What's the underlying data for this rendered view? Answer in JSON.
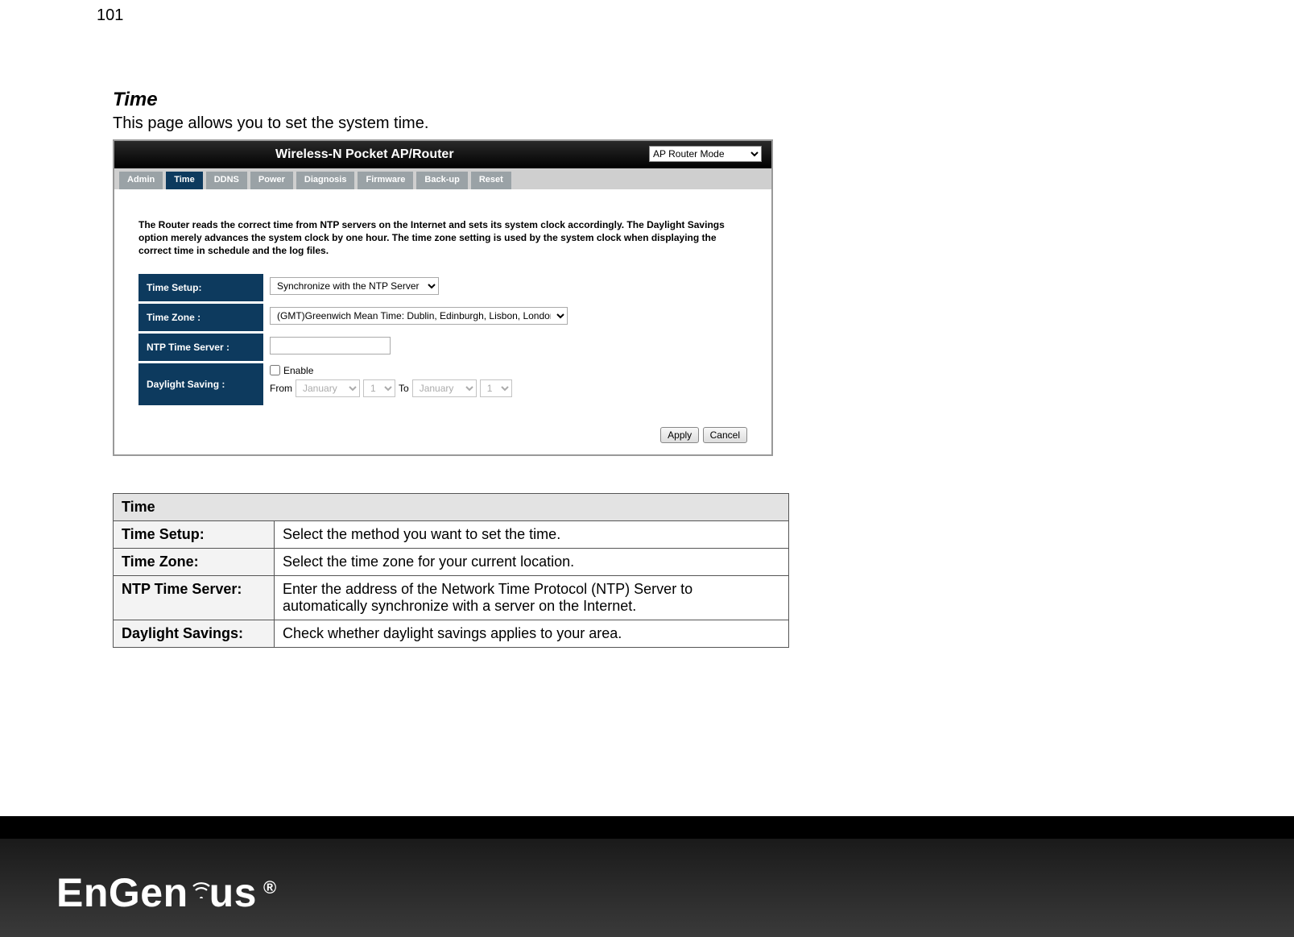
{
  "pageNumber": "101",
  "title": "Time",
  "subtitle": "This page allows you to set the system time.",
  "router": {
    "headerTitle": "Wireless-N Pocket AP/Router",
    "modeSelected": "AP Router Mode",
    "tabs": [
      "Admin",
      "Time",
      "DDNS",
      "Power",
      "Diagnosis",
      "Firmware",
      "Back-up",
      "Reset"
    ],
    "activeTab": "Time",
    "description": "The Router reads the correct time from NTP servers on the Internet and sets its system clock accordingly. The Daylight Savings option merely advances the system clock by one hour. The time zone setting is used by the system clock when displaying the correct time in schedule and the log files.",
    "form": {
      "timeSetupLabel": "Time Setup:",
      "timeSetupValue": "Synchronize with the NTP Server",
      "timeZoneLabel": "Time Zone :",
      "timeZoneValue": "(GMT)Greenwich Mean Time: Dublin, Edinburgh, Lisbon, London",
      "ntpLabel": "NTP Time Server :",
      "ntpValue": "",
      "daylightLabel": "Daylight Saving :",
      "enableLabel": "Enable",
      "fromLabel": "From",
      "toLabel": "To",
      "fromMonth": "January",
      "fromDay": "1",
      "toMonth": "January",
      "toDay": "1"
    },
    "buttons": {
      "apply": "Apply",
      "cancel": "Cancel"
    }
  },
  "info": {
    "header": "Time",
    "rows": [
      {
        "k": "Time Setup:",
        "v": "Select the method you want to set the time."
      },
      {
        "k": "Time Zone:",
        "v": "Select the time zone for your current location."
      },
      {
        "k": "NTP Time Server:",
        "v": "Enter the address of the Network Time Protocol (NTP) Server to automatically synchronize with a server on the Internet."
      },
      {
        "k": "Daylight Savings:",
        "v": "Check whether daylight savings applies to your area."
      }
    ]
  },
  "brand": "EnGenius"
}
